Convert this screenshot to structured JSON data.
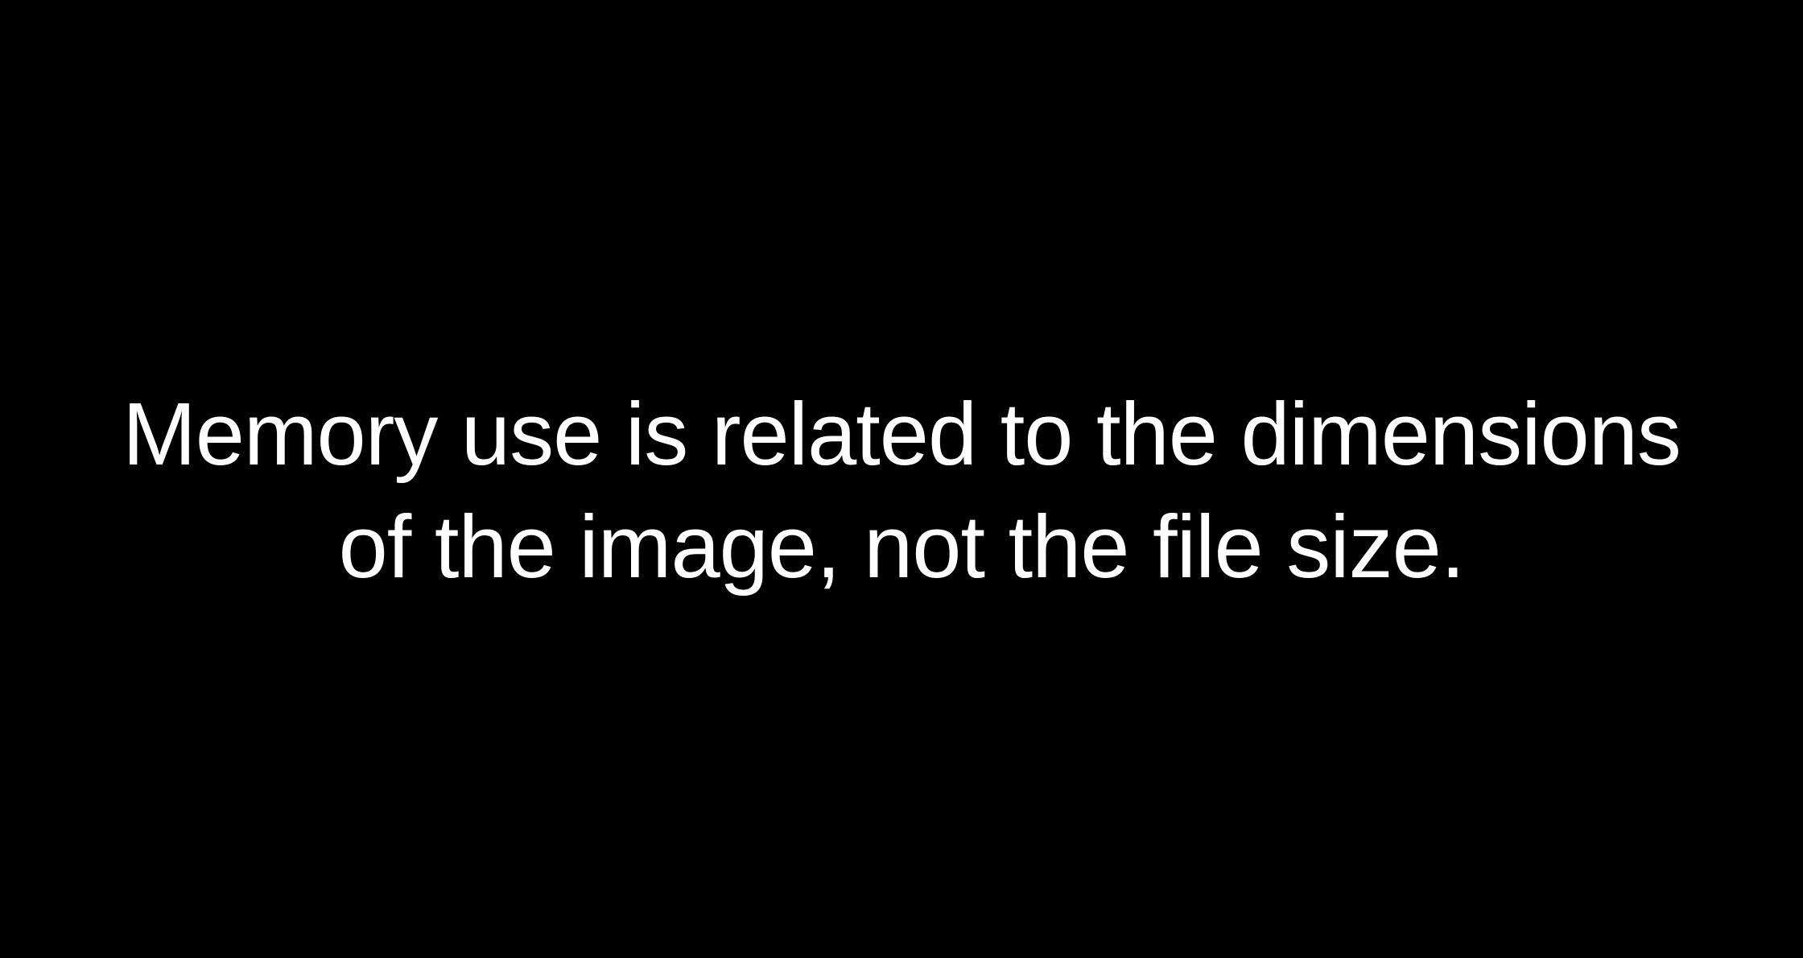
{
  "slide": {
    "background_color": "#000000",
    "text_color": "#ffffff",
    "statement_lines": [
      "Memory use is related to the dimensions",
      "of the image, not the file size."
    ]
  }
}
